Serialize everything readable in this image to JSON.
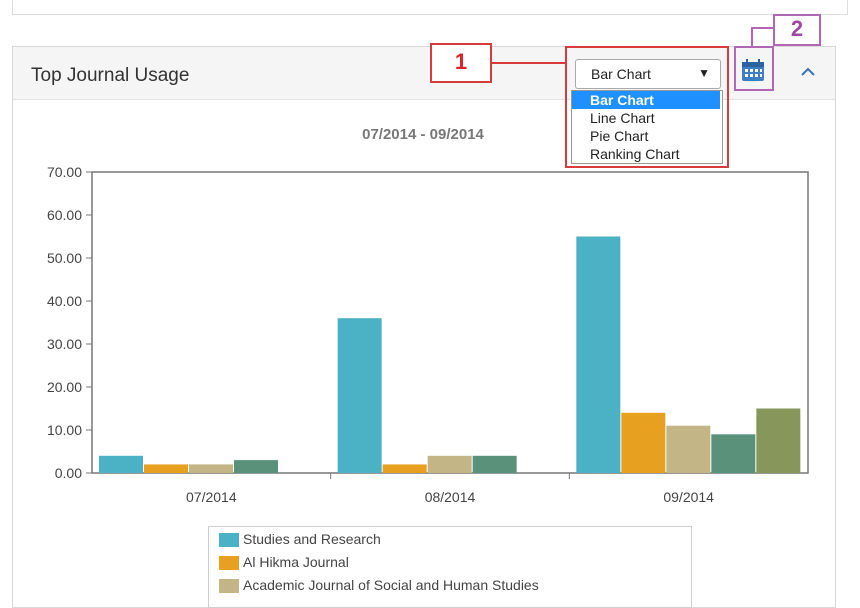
{
  "panel": {
    "title": "Top Journal Usage",
    "chart_type_select": {
      "selected": "Bar Chart",
      "options": [
        "Bar Chart",
        "Line Chart",
        "Pie Chart",
        "Ranking Chart"
      ]
    },
    "calendar_button_icon": "calendar-icon",
    "collapse_icon": "chevron-up-icon"
  },
  "annotations": {
    "callout_1": "1",
    "callout_2": "2"
  },
  "colors": {
    "series": [
      "#4bb1c4",
      "#e8a020",
      "#c4b586",
      "#5a917a",
      "#87965a"
    ],
    "callout_red": "#d73b3b",
    "callout_purple": "#b267b5",
    "select_highlight": "#1e90ff"
  },
  "chart_data": {
    "type": "bar",
    "subtitle": "07/2014 - 09/2014",
    "categories": [
      "07/2014",
      "08/2014",
      "09/2014"
    ],
    "y_ticks": [
      "0.00",
      "10.00",
      "20.00",
      "30.00",
      "40.00",
      "50.00",
      "60.00",
      "70.00"
    ],
    "ylim": [
      0,
      70
    ],
    "grid": false,
    "legend_position": "bottom",
    "series": [
      {
        "name": "Studies and Research",
        "values": [
          4,
          36,
          55
        ]
      },
      {
        "name": "Al Hikma Journal",
        "values": [
          2,
          2,
          14
        ]
      },
      {
        "name": "Academic Journal of Social and Human Studies",
        "values": [
          2,
          4,
          11
        ]
      },
      {
        "name": null,
        "values": [
          3,
          4,
          9
        ]
      },
      {
        "name": null,
        "values": [
          null,
          null,
          15
        ]
      }
    ]
  }
}
